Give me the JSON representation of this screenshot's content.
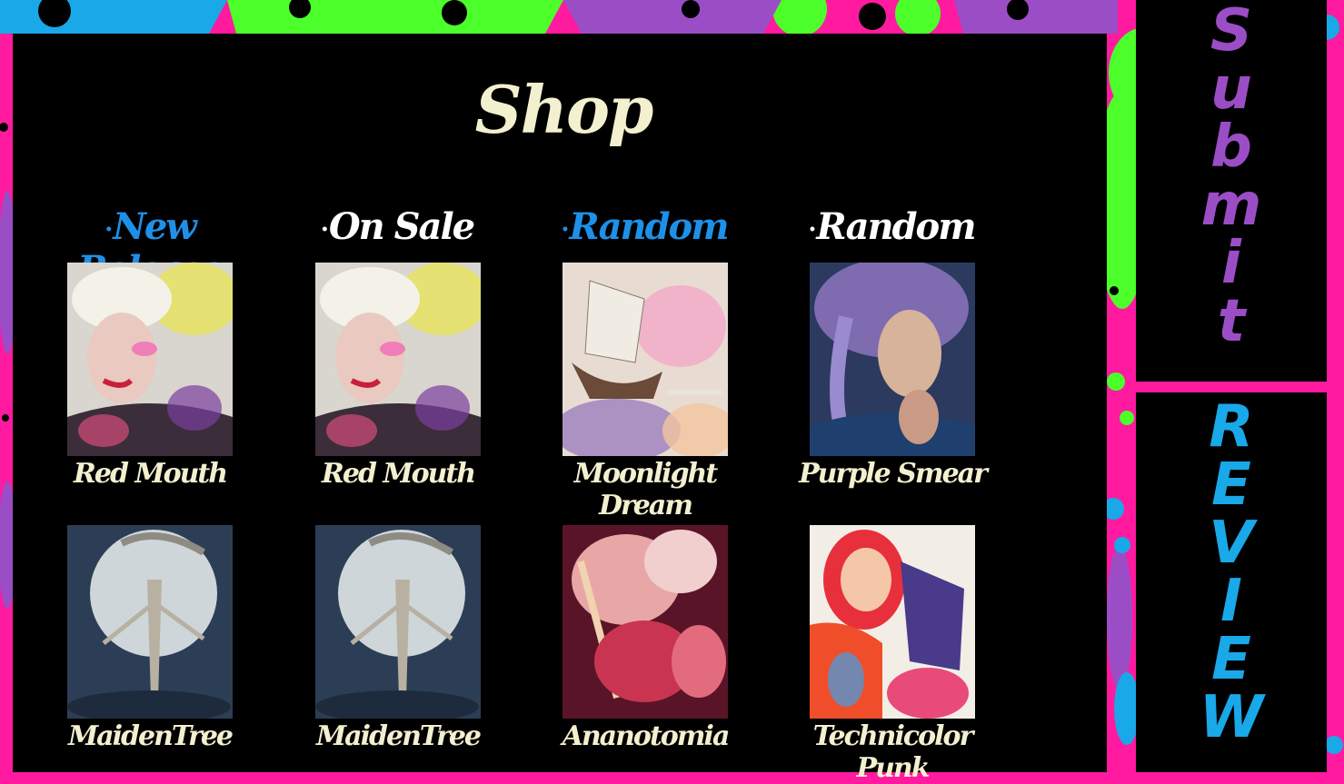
{
  "page": {
    "title": "Shop"
  },
  "colors": {
    "accent_blue": "#1e90e8",
    "cream": "#f3f0cf",
    "purple": "#9b4dc6",
    "pink": "#ff1aa0",
    "green": "#4cff2a"
  },
  "columns": [
    {
      "heading": "New Release",
      "heading_color": "blue"
    },
    {
      "heading": "On Sale",
      "heading_color": "white"
    },
    {
      "heading": "Random",
      "heading_color": "blue"
    },
    {
      "heading": "Random",
      "heading_color": "white"
    }
  ],
  "products": [
    [
      {
        "name": "Red Mouth",
        "image": "portrait-woman-white-hair"
      },
      {
        "name": "MaidenTree",
        "image": "moon-tree-figure"
      }
    ],
    [
      {
        "name": "Red Mouth",
        "image": "portrait-woman-white-hair"
      },
      {
        "name": "MaidenTree",
        "image": "moon-tree-figure"
      }
    ],
    [
      {
        "name": "Moonlight Dream",
        "image": "ship-in-clouds"
      },
      {
        "name": "Ananotomia",
        "image": "red-anatomy-painting"
      }
    ],
    [
      {
        "name": "Purple Smear",
        "image": "old-woman-portrait"
      },
      {
        "name": "Technicolor Punk",
        "image": "punk-girl-portrait"
      }
    ]
  ],
  "sidebar": {
    "submit_letters": [
      "S",
      "u",
      "b",
      "m",
      "i",
      "t"
    ],
    "review_letters": [
      "R",
      "E",
      "V",
      "I",
      "E",
      "W"
    ]
  }
}
